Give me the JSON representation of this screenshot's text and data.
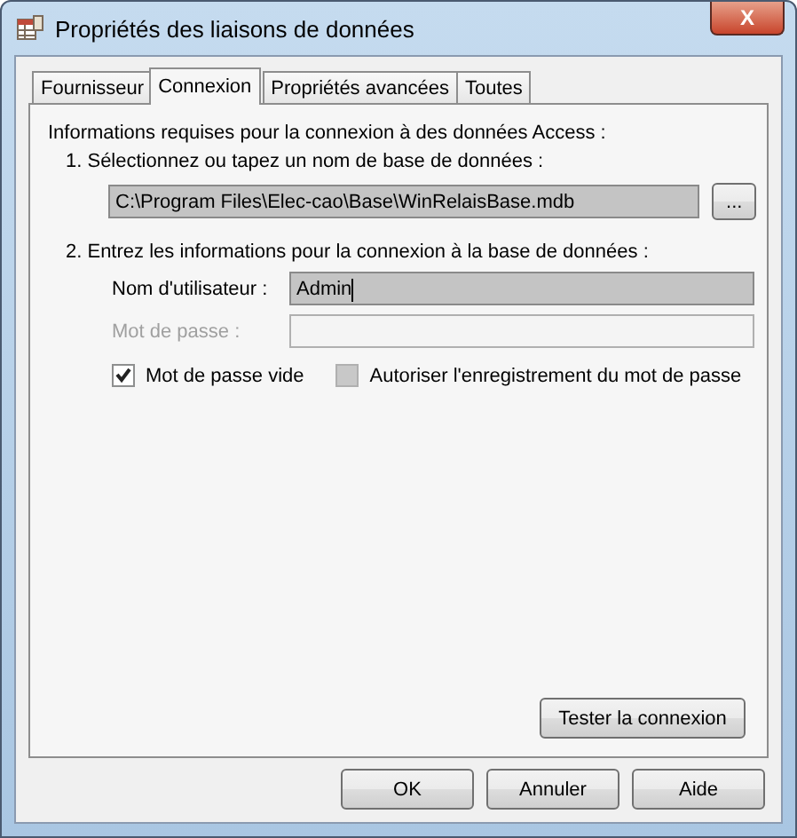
{
  "window": {
    "title": "Propriétés des liaisons de données",
    "close": "X"
  },
  "tabs": [
    {
      "label": "Fournisseur",
      "selected": false
    },
    {
      "label": "Connexion",
      "selected": true
    },
    {
      "label": "Propriétés avancées",
      "selected": false
    },
    {
      "label": "Toutes",
      "selected": false
    }
  ],
  "intro": "Informations requises pour la connexion à des données Access :",
  "step1": {
    "label": "1. Sélectionnez ou tapez un nom de base de données :",
    "value": "C:\\Program Files\\Elec-cao\\Base\\WinRelaisBase.mdb",
    "browse": "..."
  },
  "step2": {
    "label": "2. Entrez les informations pour la connexion à la base de données :",
    "fields": [
      {
        "label": "Nom d'utilisateur :",
        "value": "Admin",
        "disabled": false
      },
      {
        "label": "Mot de passe :",
        "disabled": true
      }
    ],
    "checkboxes": [
      {
        "label": "Mot de passe vide",
        "checked": true,
        "disabled": false
      },
      {
        "label": "Autoriser l'enregistrement du mot de passe",
        "checked": false,
        "disabled": true
      }
    ]
  },
  "test_button": "Tester la connexion",
  "buttons": [
    "OK",
    "Annuler",
    "Aide"
  ]
}
